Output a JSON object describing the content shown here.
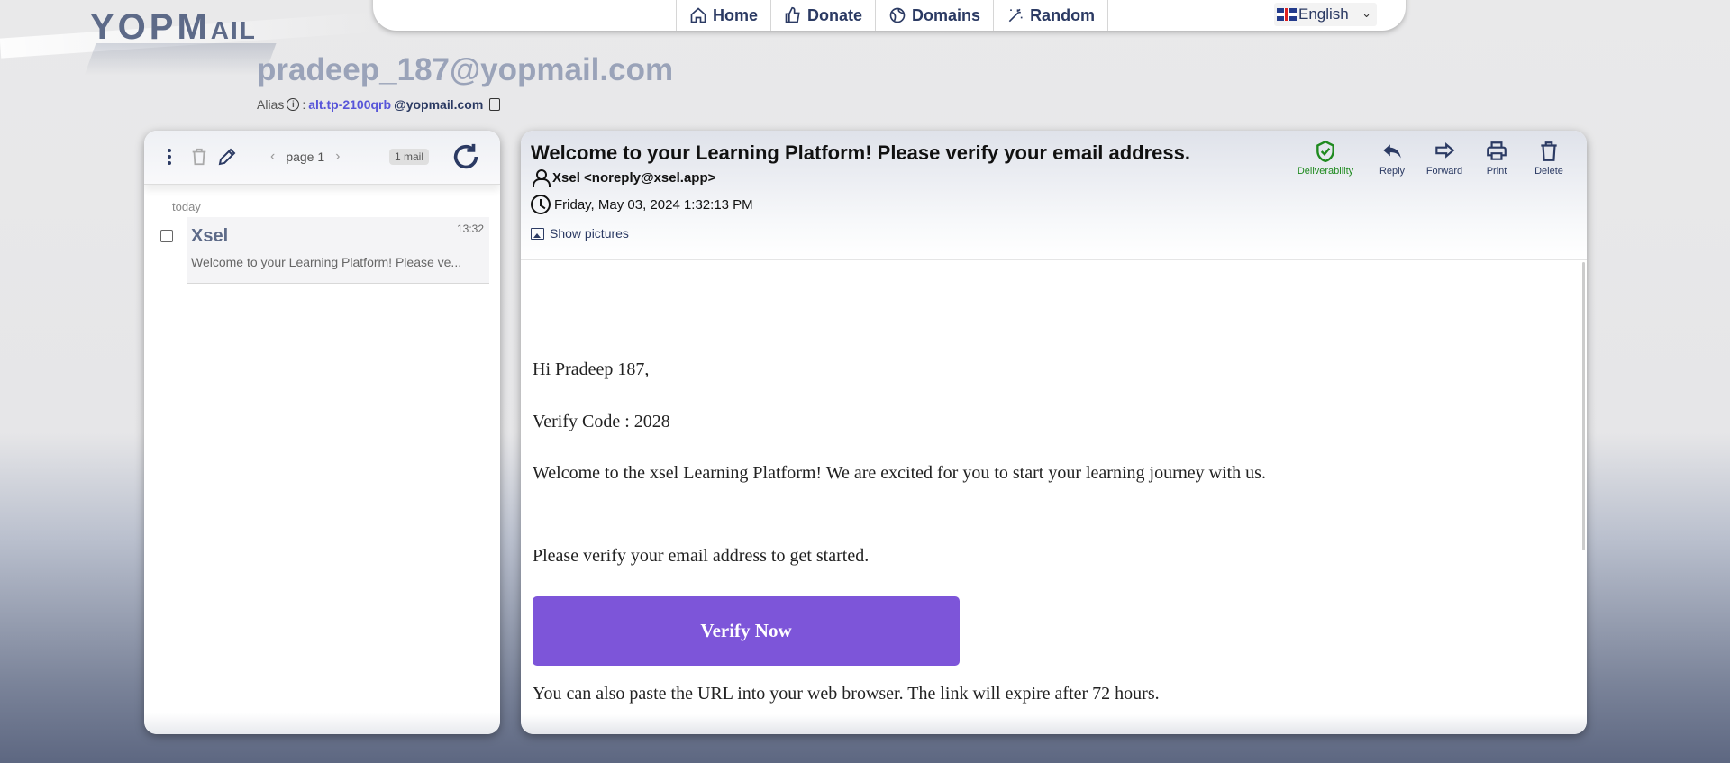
{
  "logo": {
    "text_big": "YOPM",
    "text_small": "AIL"
  },
  "nav": {
    "items": [
      {
        "label": "Home",
        "icon": "home-icon"
      },
      {
        "label": "Donate",
        "icon": "thumbs-up-icon"
      },
      {
        "label": "Domains",
        "icon": "globe-icon"
      },
      {
        "label": "Random",
        "icon": "magic-wand-icon"
      }
    ],
    "language": "English"
  },
  "mailbox": {
    "address": "pradeep_187@yopmail.com",
    "alias_label": "Alias",
    "alias_sep": ":",
    "alias_name": "alt.tp-2100qrb",
    "alias_domain": "@yopmail.com"
  },
  "inbox": {
    "page_label": "page 1",
    "count_label": "1 mail",
    "day_label": "today",
    "messages": [
      {
        "from": "Xsel",
        "time": "13:32",
        "subject": "Welcome to your Learning Platform! Please ve..."
      }
    ]
  },
  "message": {
    "subject": "Welcome to your Learning Platform! Please verify your email address.",
    "from": "Xsel <noreply@xsel.app>",
    "date": "Friday, May 03, 2024 1:32:13 PM",
    "show_pictures": "Show pictures",
    "actions": {
      "deliverability": "Deliverability",
      "reply": "Reply",
      "forward": "Forward",
      "print": "Print",
      "delete": "Delete"
    },
    "body": {
      "greeting": "Hi Pradeep 187,",
      "code_line": "Verify Code : 2028",
      "welcome": "Welcome to the xsel Learning Platform! We are excited for you to start your learning journey with us.",
      "instruction": "Please verify your email address to get started.",
      "button": "Verify Now",
      "paste": "You can also paste the URL into your web browser. The link will expire after 72 hours."
    }
  },
  "colors": {
    "accent": "#7d55d9",
    "nav_text": "#2b3a63",
    "deliverability": "#1f8a1f"
  }
}
